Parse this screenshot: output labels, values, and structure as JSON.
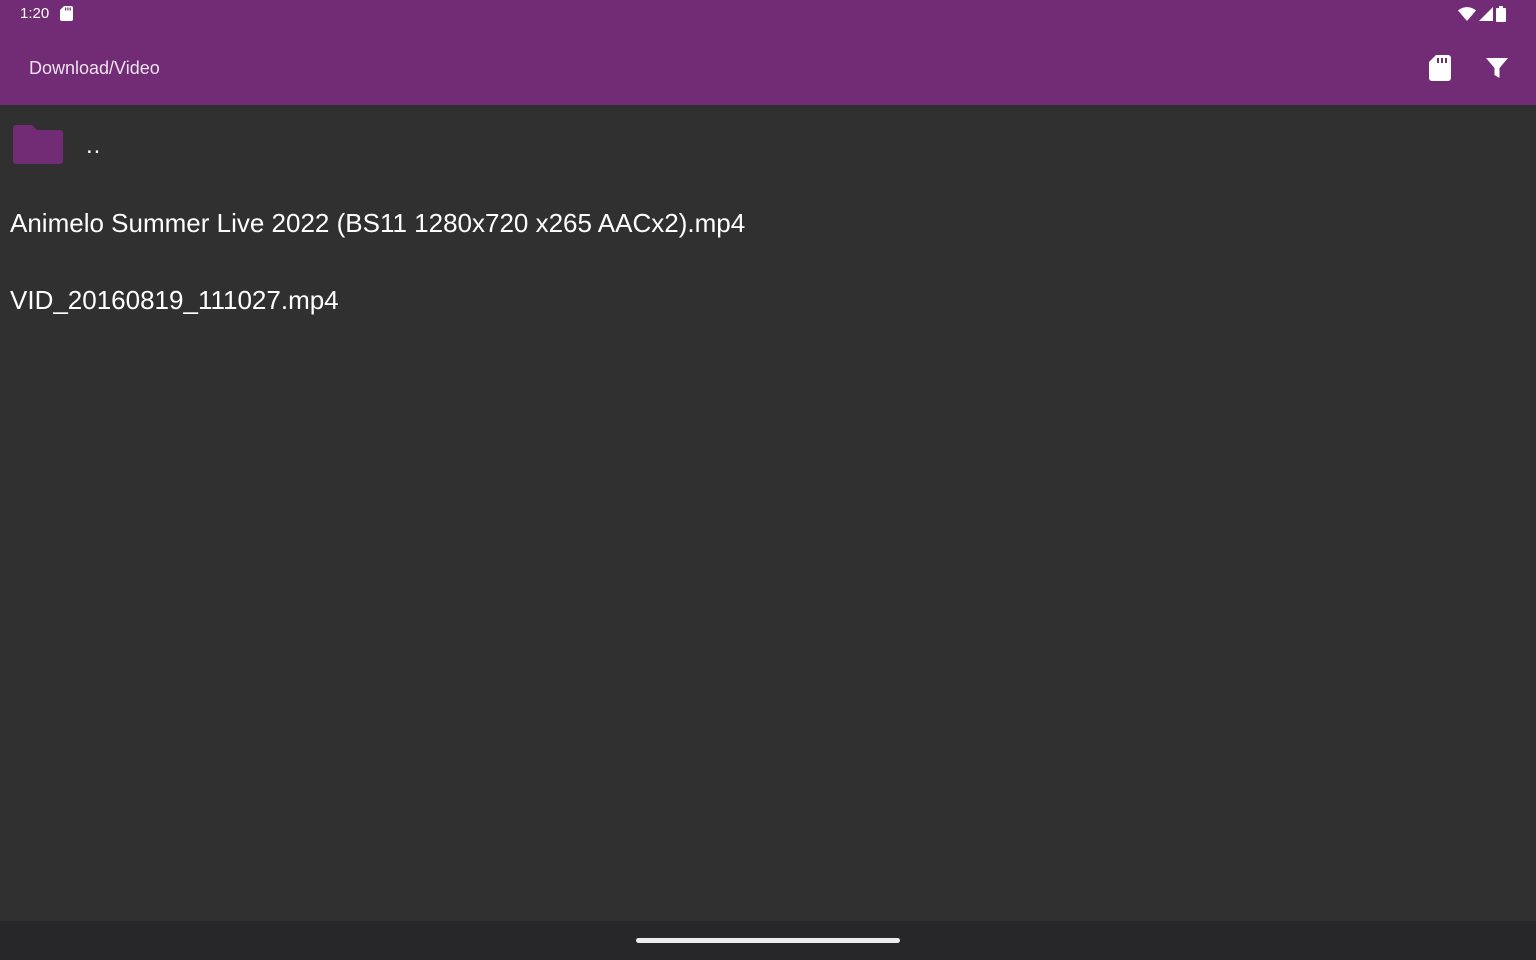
{
  "status_bar": {
    "time": "1:20",
    "left_icons": [
      "sd-card-icon"
    ],
    "right_icons": [
      "wifi-icon",
      "cellular-signal-icon",
      "battery-icon"
    ]
  },
  "app_bar": {
    "path": "Download/Video",
    "actions": [
      {
        "icon": "sd-card-icon"
      },
      {
        "icon": "filter-icon"
      }
    ],
    "color": "#722b75"
  },
  "file_list": {
    "parent": {
      "label": "..",
      "icon": "folder-icon",
      "icon_color": "#722b75"
    },
    "files": [
      {
        "name": "Animelo Summer Live 2022 (BS11 1280x720 x265 AACx2).mp4"
      },
      {
        "name": "VID_20160819_111027.mp4"
      }
    ]
  },
  "colors": {
    "background": "#303030",
    "nav_bar": "#27272a",
    "text": "#ffffff"
  }
}
